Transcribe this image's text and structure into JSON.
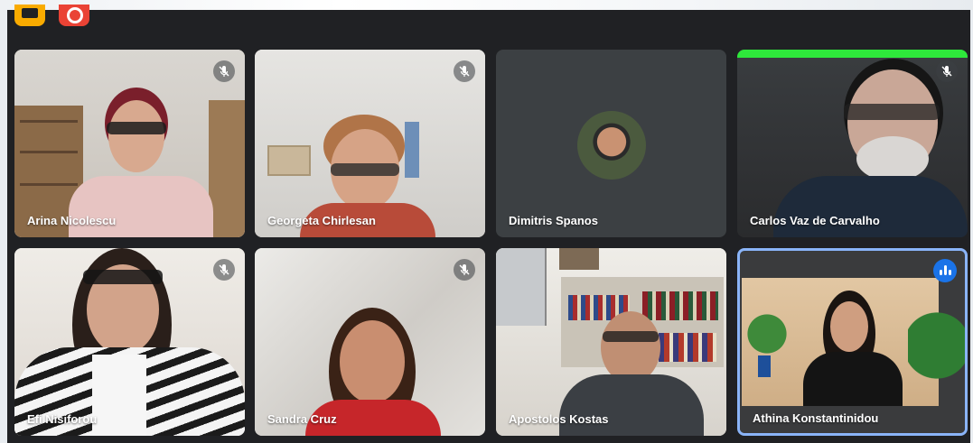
{
  "toolbar": {
    "left_button": "caption-icon",
    "right_button": "record-icon"
  },
  "participants": [
    {
      "name": "Arina Nicolescu",
      "muted": true
    },
    {
      "name": "Georgeta Chirlesan",
      "muted": true
    },
    {
      "name": "Dimitris Spanos",
      "muted": false
    },
    {
      "name": "Carlos Vaz de Carvalho",
      "muted": true
    },
    {
      "name": "Efi Nisiforou",
      "muted": true
    },
    {
      "name": "Sandra Cruz",
      "muted": true
    },
    {
      "name": "Apostolos Kostas",
      "muted": false
    },
    {
      "name": "Athina Konstantinidou",
      "muted": false,
      "speaking": true
    }
  ],
  "colors": {
    "background": "#202124",
    "active_border": "#8ab4f8",
    "speaking_badge": "#1a73e8"
  }
}
